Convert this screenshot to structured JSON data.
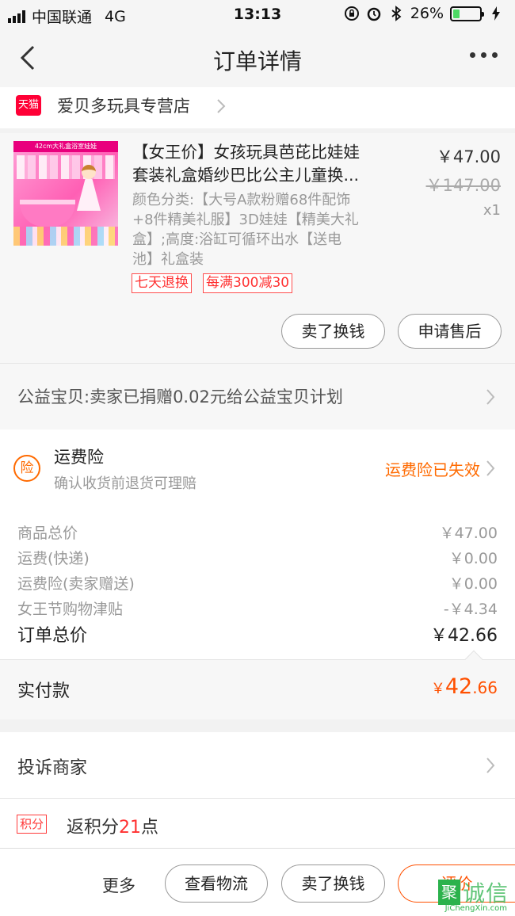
{
  "status_bar": {
    "carrier": "中国联通",
    "network": "4G",
    "time": "13:13",
    "battery": "26%",
    "battery_level": 0.26
  },
  "nav": {
    "title": "订单详情"
  },
  "shop": {
    "badge": "天猫",
    "name": "爱贝多玩具专营店"
  },
  "product": {
    "image_banner": "42cm大礼盒浴室娃娃",
    "title_line1": "【女王价】女孩玩具芭芘比娃娃",
    "title_line2": "套装礼盒婚纱巴比公主儿童换...",
    "sku_line1": "颜色分类:【大号A款粉赠68件配饰",
    "sku_line2": "+8件精美礼服】3D娃娃【精美大礼",
    "sku_line3": "盒】;高度:浴缸可循环出水【送电",
    "sku_line4": "池】礼盒装",
    "price": "￥47.00",
    "original_price": "￥147.00",
    "quantity": "x1",
    "tags": [
      "七天退换",
      "每满300减30"
    ],
    "buttons": {
      "sell": "卖了换钱",
      "after_sale": "申请售后"
    }
  },
  "charity": {
    "text": "公益宝贝:卖家已捐赠0.02元给公益宝贝计划"
  },
  "insurance": {
    "icon": "险",
    "title": "运费险",
    "desc": "确认收货前退货可理赔",
    "status": "运费险已失效"
  },
  "breakdown": [
    {
      "label": "商品总价",
      "value": "￥47.00"
    },
    {
      "label": "运费(快递)",
      "value": "￥0.00"
    },
    {
      "label": "运费险(卖家赠送)",
      "value": "￥0.00"
    },
    {
      "label": "女王节购物津贴",
      "value": "-￥4.34"
    }
  ],
  "order_total": {
    "label": "订单总价",
    "value": "￥42.66"
  },
  "paid": {
    "label": "实付款",
    "currency": "￥",
    "integer": "42",
    "decimal": ".66"
  },
  "complain": {
    "label": "投诉商家"
  },
  "points": {
    "badge": "积分",
    "prefix": "返积分",
    "amount": "21",
    "suffix": "点"
  },
  "actions": {
    "more": "更多",
    "logistics": "查看物流",
    "sell": "卖了换钱",
    "review": "评价"
  },
  "watermark": {
    "box": "聚",
    "text": "诚信",
    "url": "JiChengXin.com"
  },
  "colors": {
    "accent": "#ff5000",
    "insurance": "#ff6a00",
    "tmall": "#ff0036",
    "tag": "#ff3030",
    "watermark": "#2bb24c"
  }
}
